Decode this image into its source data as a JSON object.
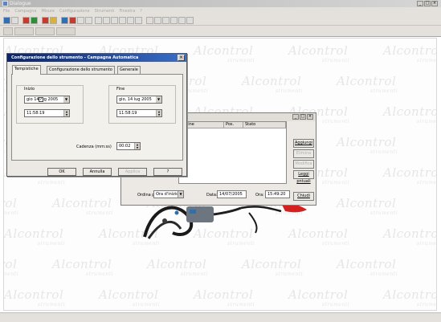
{
  "app": {
    "title": "Dialogue"
  },
  "menubar": [
    "File",
    "Campagna",
    "Misure",
    "Configurazione",
    "Strumenti",
    "Finestra",
    "?"
  ],
  "workspace": {
    "watermark": "Alcontrol",
    "watermark_sub": "strumenti"
  },
  "campaign_window": {
    "columns": [
      "Id. line",
      "Pos.",
      "Stato"
    ],
    "buttons": {
      "add": "Aggiungi",
      "remove": "Elimina",
      "modify": "Modifica",
      "read": "Leggi pntuali",
      "close": "Chiudi"
    },
    "order_label": "Ordina per:",
    "order_value": "Ora d'inizio",
    "date_label": "Data:",
    "date_value": "14/07/2005",
    "time_label": "Ora:",
    "time_value": "15:49:20"
  },
  "dialog": {
    "title": "Configurazione dello strumento - Campagna Automatica",
    "tabs": [
      "Tempistiche",
      "Configurazione dello strumento",
      "Generale"
    ],
    "start": {
      "label": "Inizio",
      "date": "gio 14 lug 2005",
      "time": "11:58:19"
    },
    "end": {
      "label": "Fine",
      "date": "gio, 14 lug 2005",
      "time": "11:58:19"
    },
    "cadence": {
      "label": "Cadenza (mm:ss)",
      "value": "00:02"
    },
    "buttons": {
      "ok": "OK",
      "cancel": "Annulla",
      "apply": "Applica",
      "help": "?"
    }
  }
}
